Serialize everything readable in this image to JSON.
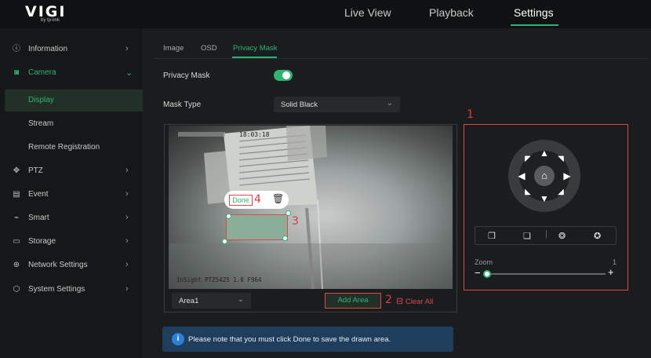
{
  "brand": {
    "logo": "VIGI",
    "sub": "by tp-link"
  },
  "nav": {
    "live_view": "Live View",
    "playback": "Playback",
    "settings": "Settings"
  },
  "sidebar": {
    "items": [
      {
        "label": "Information",
        "icon": "info-icon"
      },
      {
        "label": "Camera",
        "icon": "camera-icon"
      },
      {
        "label": "Display",
        "icon": ""
      },
      {
        "label": "Stream",
        "icon": ""
      },
      {
        "label": "Remote Registration",
        "icon": ""
      },
      {
        "label": "PTZ",
        "icon": "ptz-icon"
      },
      {
        "label": "Event",
        "icon": "event-icon"
      },
      {
        "label": "Smart",
        "icon": "smart-icon"
      },
      {
        "label": "Storage",
        "icon": "storage-icon"
      },
      {
        "label": "Network Settings",
        "icon": "globe-icon"
      },
      {
        "label": "System Settings",
        "icon": "system-icon"
      }
    ]
  },
  "tabs": {
    "image": "Image",
    "osd": "OSD",
    "privacy_mask": "Privacy Mask"
  },
  "form": {
    "privacy_mask_label": "Privacy Mask",
    "privacy_mask_enabled": true,
    "mask_type_label": "Mask Type",
    "mask_type_value": "Solid Black"
  },
  "video": {
    "timestamp": "18:03:18",
    "camera_name": "InSight PTZ5425 1.0 F964",
    "done_label": "Done",
    "area_value": "Area1",
    "add_area_label": "Add Area",
    "clear_all_label": "Clear All"
  },
  "annotations": {
    "a1": "1",
    "a2": "2",
    "a3": "3",
    "a4": "4"
  },
  "note": "Please note that you must click Done to save the drawn area.",
  "ptz": {
    "zoom_label": "Zoom",
    "zoom_value": "1",
    "zoom_level": 0.0
  },
  "colors": {
    "accent": "#2fb373",
    "annotation": "#e0383b",
    "note_bg": "#1f3d5c"
  }
}
